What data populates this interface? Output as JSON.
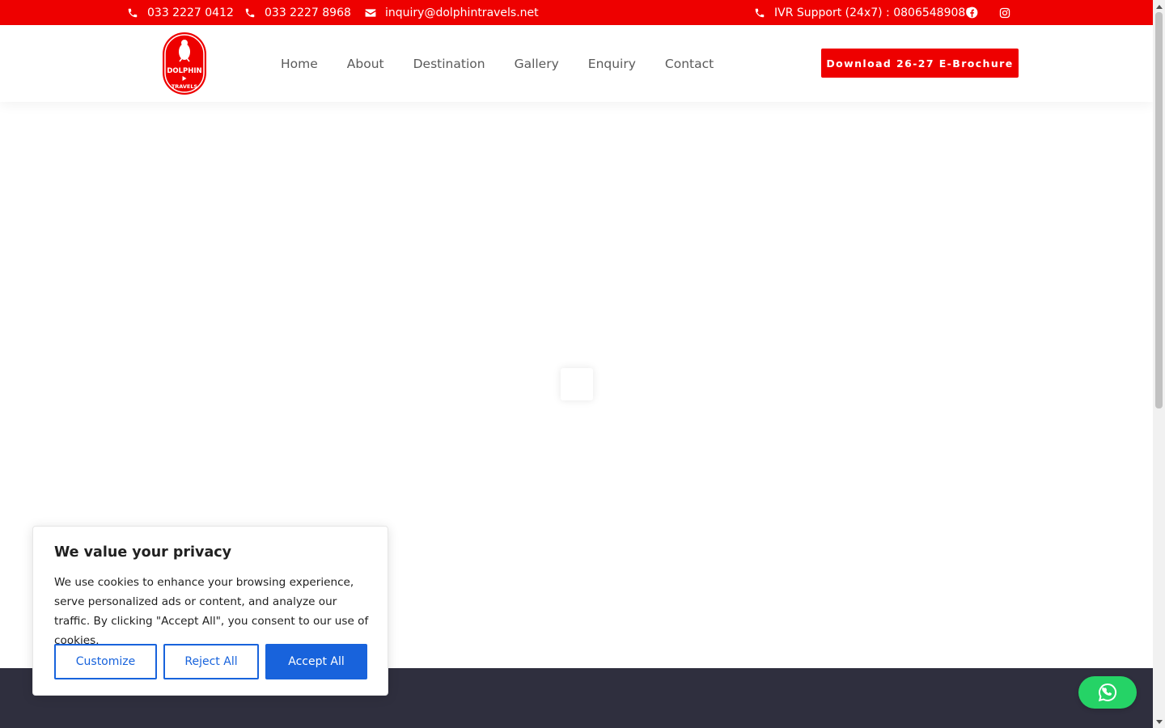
{
  "topbar": {
    "phone1": "033 2227 0412",
    "phone2": "033 2227 8968",
    "email": "inquiry@dolphintravels.net",
    "ivr": "IVR Support (24x7) : 08065489080",
    "bg_color": "#ee0000",
    "icons": [
      "phone-icon",
      "phone-icon",
      "envelope-icon",
      "phone-icon",
      "facebook-icon",
      "instagram-icon"
    ]
  },
  "header": {
    "logo_line1": "DOLPHIN",
    "logo_line2": "TRAVELS",
    "nav": [
      "Home",
      "About",
      "Destination",
      "Gallery",
      "Enquiry",
      "Contact"
    ],
    "cta": "Download 26-27 E-Brochure",
    "cta_color": "#ee0000"
  },
  "cookie": {
    "title": "We value your privacy",
    "text": "We use cookies to enhance your browsing experience, serve personalized ads or content, and analyze our traffic. By clicking \"Accept All\", you consent to our use of cookies.",
    "customize": "Customize",
    "reject": "Reject All",
    "accept": "Accept All",
    "accent_color": "#1863dc"
  },
  "whatsapp": {
    "icon": "whatsapp-icon",
    "color": "#25d366"
  },
  "footer": {
    "bg_color": "#2f2f3e"
  }
}
